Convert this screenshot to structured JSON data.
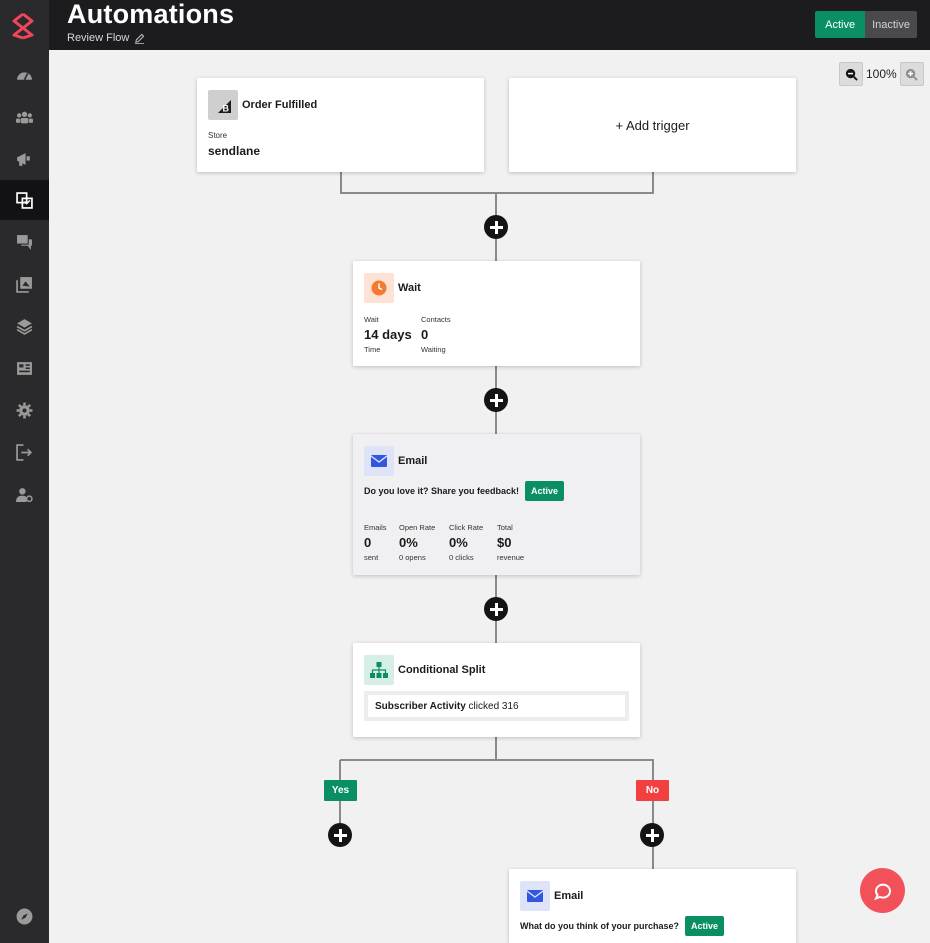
{
  "header": {
    "title": "Automations",
    "flow_name": "Review Flow",
    "status_active": "Active",
    "status_inactive": "Inactive"
  },
  "sidebar": {
    "items": [
      {
        "icon": "dashboard-icon"
      },
      {
        "icon": "contacts-icon"
      },
      {
        "icon": "campaigns-icon"
      },
      {
        "icon": "automations-icon",
        "active": true
      },
      {
        "icon": "conversations-icon"
      },
      {
        "icon": "forms-icon"
      },
      {
        "icon": "integrations-icon"
      },
      {
        "icon": "reports-icon"
      },
      {
        "icon": "settings-icon"
      },
      {
        "icon": "logout-icon"
      },
      {
        "icon": "account-settings-icon"
      },
      {
        "icon": "compass-icon"
      }
    ]
  },
  "zoom": {
    "level": "100%"
  },
  "trigger": {
    "title": "Order Fulfilled",
    "store_label": "Store",
    "store_value": "sendlane",
    "add_trigger": "+ Add trigger"
  },
  "wait": {
    "title": "Wait",
    "wait_label": "Wait",
    "wait_value": "14 days",
    "wait_sub": "Time",
    "contacts_label": "Contacts",
    "contacts_value": "0",
    "contacts_sub": "Waiting"
  },
  "email1": {
    "title": "Email",
    "subject": "Do you love it? Share you feedback!",
    "badge": "Active",
    "stats": [
      {
        "label": "Emails",
        "value": "0",
        "sub": "sent"
      },
      {
        "label": "Open Rate",
        "value": "0%",
        "sub": "0 opens"
      },
      {
        "label": "Click Rate",
        "value": "0%",
        "sub": "0 clicks"
      },
      {
        "label": "Total",
        "value": "$0",
        "sub": "revenue"
      }
    ]
  },
  "split": {
    "title": "Conditional Split",
    "condition_bold": "Subscriber Activity",
    "condition_rest": " clicked 316",
    "yes": "Yes",
    "no": "No"
  },
  "email2": {
    "title": "Email",
    "subject": "What do you think of your purchase?",
    "badge": "Active"
  },
  "colors": {
    "accent_green": "#0a8f64",
    "no_red": "#f1403f",
    "chat_button": "#f2515a",
    "brand_pink": "#f0455b"
  }
}
